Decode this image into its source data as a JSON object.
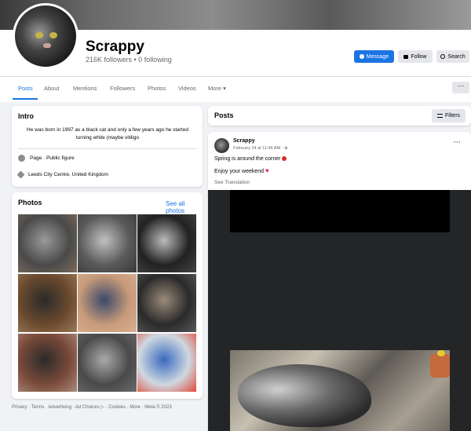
{
  "page": {
    "name": "Scrappy",
    "followers_line": "216K followers • 0 following"
  },
  "actions": {
    "message": "Message",
    "follow": "Follow",
    "search": "Search",
    "more": "···"
  },
  "tabs": [
    {
      "label": "Posts",
      "active": true
    },
    {
      "label": "About"
    },
    {
      "label": "Mentions"
    },
    {
      "label": "Followers"
    },
    {
      "label": "Photos"
    },
    {
      "label": "Videos"
    },
    {
      "label": "More ▾"
    }
  ],
  "intro": {
    "title": "Intro",
    "bio": "He was born in 1997 as a black cat and only a few years ago he started turning white (maybe vitiligo",
    "category": "Page · Public figure",
    "location": "Leeds City Centre, United Kingdom"
  },
  "photos": {
    "title": "Photos",
    "see_all": "See all photos",
    "items": [
      {
        "alt": "cat on paving",
        "colors": [
          "#4a4a4a",
          "#9a9a9a",
          "#7a6a5a"
        ]
      },
      {
        "alt": "cat face close up",
        "colors": [
          "#5a5a5a",
          "#c0c0c0",
          "#3a3a3a"
        ]
      },
      {
        "alt": "cat in black and white",
        "colors": [
          "#222",
          "#bbb",
          "#444"
        ]
      },
      {
        "alt": "cat sitting indoors",
        "colors": [
          "#6b4a2e",
          "#2a2a2a",
          "#9a7a5a"
        ]
      },
      {
        "alt": "man holding cat",
        "colors": [
          "#c79a7a",
          "#3a4a6a",
          "#d8b090"
        ]
      },
      {
        "alt": "cat face portrait",
        "colors": [
          "#2a2a2a",
          "#9a8a7a",
          "#5a5a5a"
        ]
      },
      {
        "alt": "cat lying on floor",
        "colors": [
          "#7a4a3a",
          "#2a2a2a",
          "#aa8a7a"
        ]
      },
      {
        "alt": "cat close up gray",
        "colors": [
          "#4a4a4a",
          "#aaa",
          "#6a6a6a"
        ]
      },
      {
        "alt": "child with toys",
        "colors": [
          "#cfd8e0",
          "#3a6ac0",
          "#e04a3a"
        ]
      }
    ]
  },
  "footer": "Privacy · Terms · Advertising · Ad Choices ▷ · Cookies · More · Meta © 2023",
  "posts": {
    "title": "Posts",
    "filters": "Filters"
  },
  "post": {
    "author": "Scrappy",
    "meta": "February 24 at 11:46 AM · ⊕",
    "menu": "···",
    "line1": "Spring is around the corner",
    "line2": "Enjoy your weekend",
    "see_translation": "See Translation"
  },
  "colors": {
    "accent": "#1b74e4",
    "page_bg": "#f0f2f5",
    "media_bg": "#242526"
  }
}
